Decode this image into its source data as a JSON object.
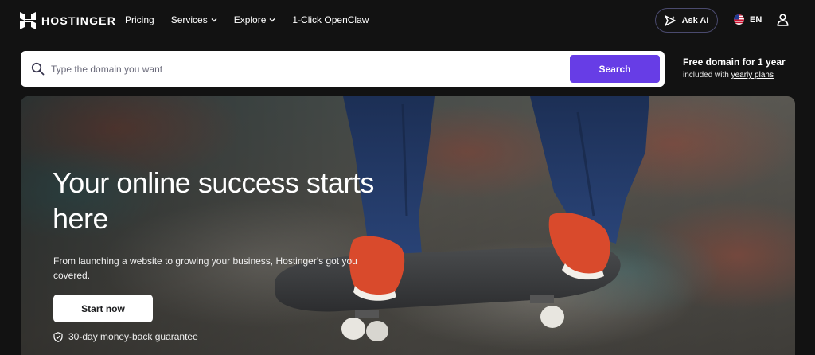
{
  "brand": {
    "name": "HOSTINGER"
  },
  "nav": {
    "links": [
      {
        "label": "Pricing",
        "has_dropdown": false
      },
      {
        "label": "Services",
        "has_dropdown": true
      },
      {
        "label": "Explore",
        "has_dropdown": true
      },
      {
        "label": "1-Click OpenClaw",
        "has_dropdown": false
      }
    ],
    "ask_ai_label": "Ask AI",
    "language": "EN",
    "icons": {
      "ask_ai": "sparkle-arrow-icon",
      "language": "us-flag-icon",
      "account": "user-icon"
    }
  },
  "search": {
    "placeholder": "Type the domain you want",
    "value": "",
    "button_label": "Search"
  },
  "promo": {
    "title": "Free domain for 1 year",
    "subtitle_prefix": "included with ",
    "subtitle_link": "yearly plans"
  },
  "hero": {
    "title": "Your online success starts here",
    "subtitle": "From launching a website to growing your business, Hostinger's got you covered.",
    "cta_label": "Start now",
    "guarantee": "30-day money-back guarantee"
  },
  "colors": {
    "page_background": "#121212",
    "accent": "#673de6",
    "search_background": "#ffffff",
    "cta_background": "#ffffff"
  }
}
